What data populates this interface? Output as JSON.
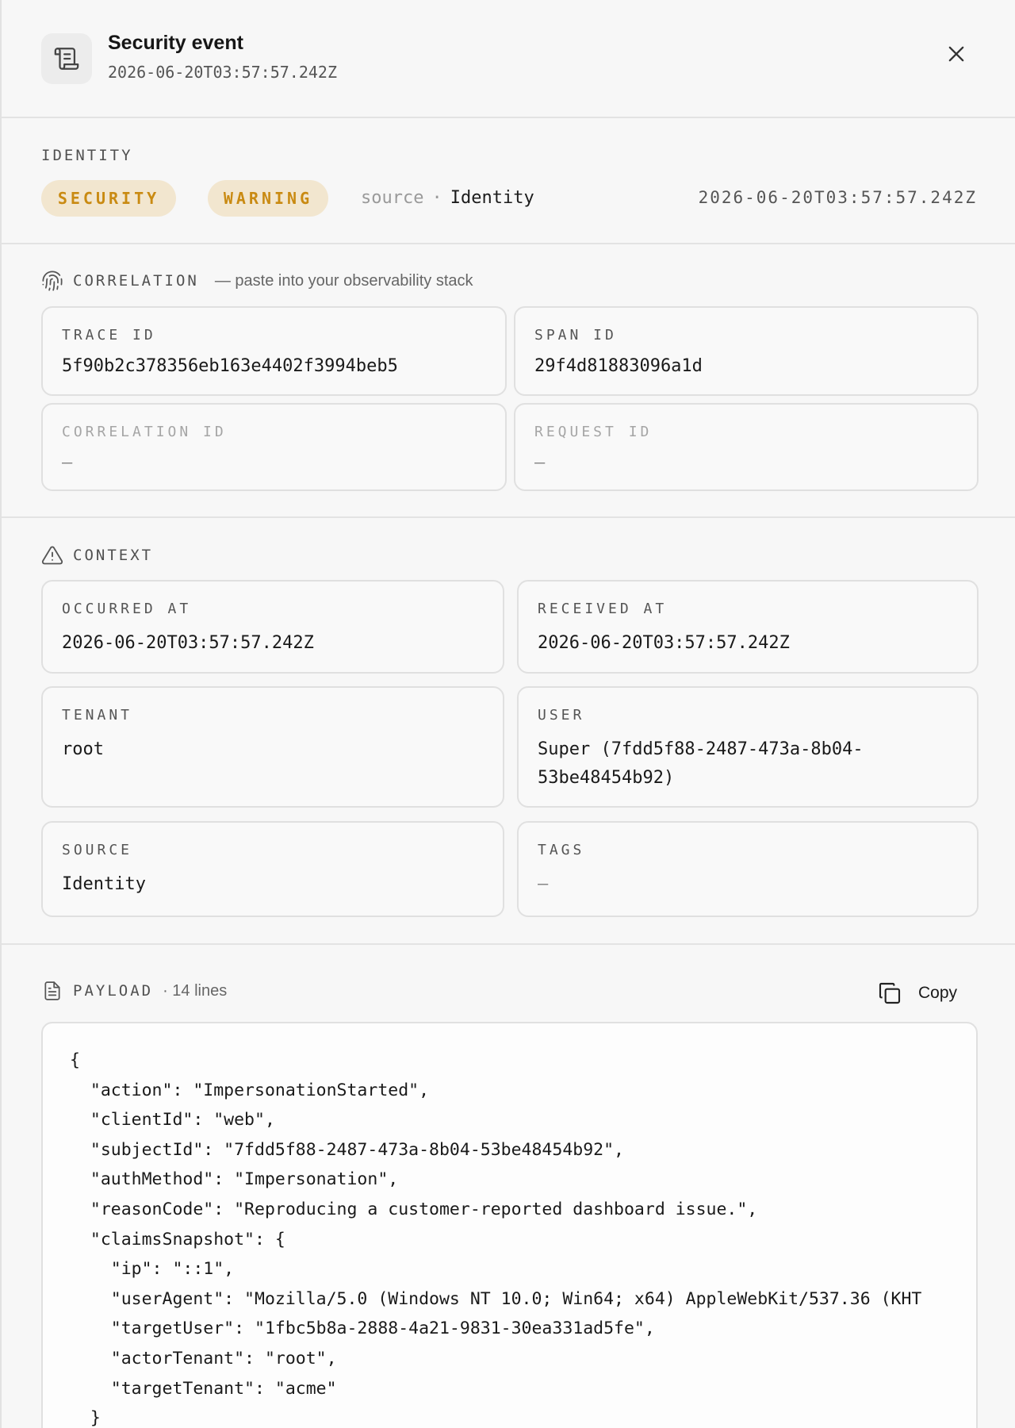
{
  "header": {
    "title": "Security event",
    "timestamp": "2026-06-20T03:57:57.242Z",
    "icon": "scroll-icon",
    "close_icon": "close-icon"
  },
  "identity": {
    "label": "IDENTITY",
    "badges": [
      "SECURITY",
      "WARNING"
    ],
    "source_key": "source",
    "separator": "·",
    "source_value": "Identity",
    "timestamp": "2026-06-20T03:57:57.242Z"
  },
  "correlation": {
    "label": "CORRELATION",
    "note": "— paste into your observability stack",
    "icon": "fingerprint-icon",
    "fields": [
      {
        "label": "TRACE ID",
        "value": "5f90b2c378356eb163e4402f3994beb5"
      },
      {
        "label": "SPAN ID",
        "value": "29f4d81883096a1d"
      },
      {
        "label": "CORRELATION ID",
        "value": "—"
      },
      {
        "label": "REQUEST ID",
        "value": "—"
      }
    ]
  },
  "context": {
    "label": "CONTEXT",
    "icon": "warning-triangle-icon",
    "fields": [
      {
        "label": "OCCURRED AT",
        "value": "2026-06-20T03:57:57.242Z"
      },
      {
        "label": "RECEIVED AT",
        "value": "2026-06-20T03:57:57.242Z"
      },
      {
        "label": "TENANT",
        "value": "root"
      },
      {
        "label": "USER",
        "value": "Super (7fdd5f88-2487-473a-8b04-53be48454b92)"
      },
      {
        "label": "SOURCE",
        "value": "Identity"
      },
      {
        "label": "TAGS",
        "value": "—"
      }
    ]
  },
  "payload": {
    "label": "PAYLOAD",
    "meta": "· 14 lines",
    "icon": "document-icon",
    "copy_label": "Copy",
    "copy_icon": "copy-icon",
    "lines": [
      "{",
      "  \"action\": \"ImpersonationStarted\",",
      "  \"clientId\": \"web\",",
      "  \"subjectId\": \"7fdd5f88-2487-473a-8b04-53be48454b92\",",
      "  \"authMethod\": \"Impersonation\",",
      "  \"reasonCode\": \"Reproducing a customer-reported dashboard issue.\",",
      "  \"claimsSnapshot\": {",
      "    \"ip\": \"::1\",",
      "    \"userAgent\": \"Mozilla/5.0 (Windows NT 10.0; Win64; x64) AppleWebKit/537.36 (KHT",
      "    \"targetUser\": \"1fbc5b8a-2888-4a21-9831-30ea331ad5fe\",",
      "    \"actorTenant\": \"root\",",
      "    \"targetTenant\": \"acme\"",
      "  }"
    ]
  },
  "colors": {
    "badge_bg": "#f2e6cf",
    "badge_text": "#c98a12"
  }
}
